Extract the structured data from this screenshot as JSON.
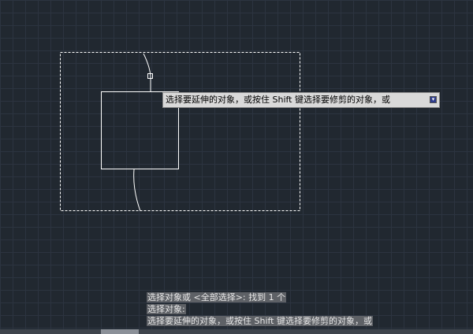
{
  "tooltip": {
    "text": "选择要延伸的对象，或按住 Shift 键选择要修剪的对象，或",
    "dropdown_icon": "dropdown-arrow-icon"
  },
  "command_history": [
    "选择对象或 <全部选择>: 找到 1 个",
    "选择对象:",
    "选择要延伸的对象，或按住 Shift 键选择要修剪的对象，或"
  ]
}
